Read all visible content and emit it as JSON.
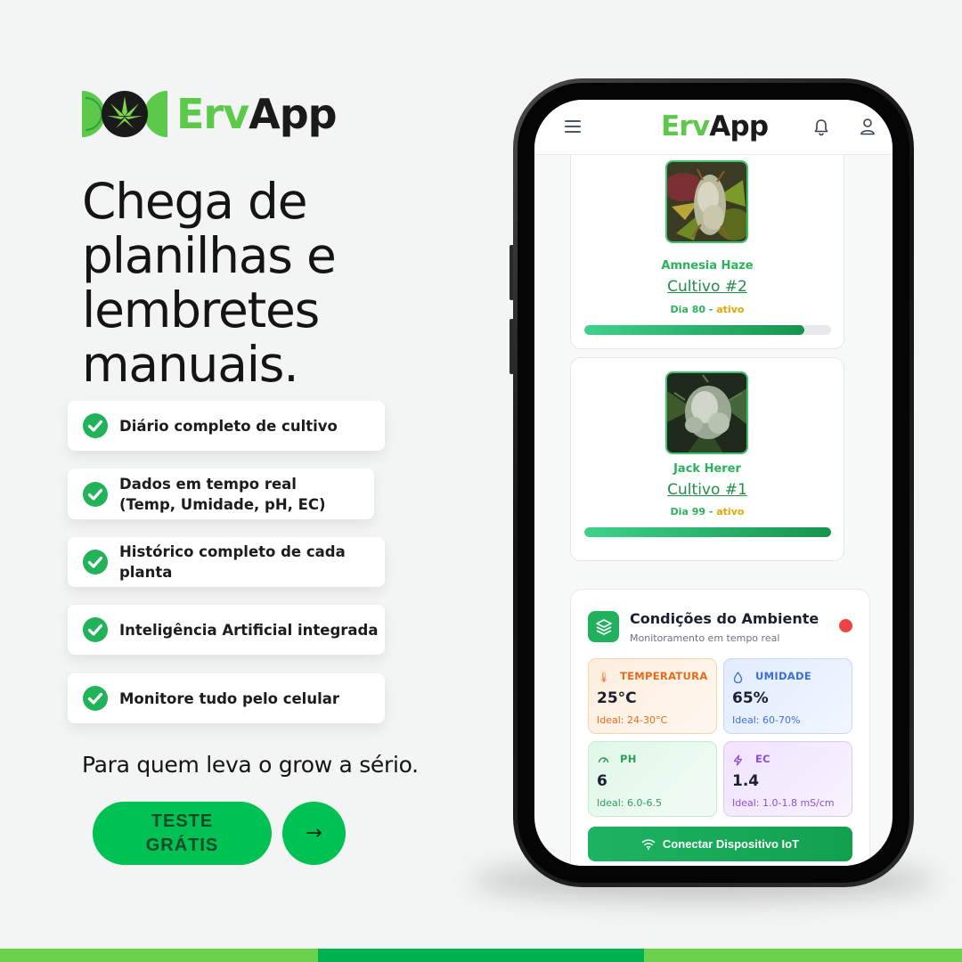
{
  "brand": {
    "logo_erv": "Erv",
    "logo_app": "App"
  },
  "headline": [
    "Chega de",
    "planilhas e",
    "lembretes",
    "manuais."
  ],
  "features": [
    {
      "label": "Diário completo de cultivo",
      "icon": "check-circle-icon"
    },
    {
      "label": "Dados em tempo real (Temp, Umidade, pH, EC)",
      "icon": "check-circle-icon"
    },
    {
      "label": "Histórico completo de cada planta",
      "icon": "check-circle-icon"
    },
    {
      "label": "Inteligência Artificial integrada",
      "icon": "check-circle-icon"
    },
    {
      "label": "Monitore tudo pelo celular",
      "icon": "check-circle-icon"
    }
  ],
  "tagline": "Para quem leva o grow a sério.",
  "cta": {
    "label": "TESTE GRÁTIS",
    "arrow": "→"
  },
  "colors": {
    "brand_green": "#5cc94a",
    "cta_green": "#00c153",
    "stripe_light": "#6bd24b",
    "stripe_dark": "#00b14f",
    "alert_red": "#ef4444"
  },
  "app": {
    "header": {
      "logo_erv": "Erv",
      "logo_app": "App",
      "icons": [
        "menu-icon",
        "bell-icon",
        "user-icon"
      ]
    },
    "grows": [
      {
        "strain": "Amnesia Haze",
        "title": "Cultivo #2",
        "day": "Dia 80",
        "status": "ativo",
        "progress": 0.89
      },
      {
        "strain": "Jack Herer",
        "title": "Cultivo #1",
        "day": "Dia 99",
        "status": "ativo",
        "progress": 1.0
      }
    ],
    "environment": {
      "title": "Condições do Ambiente",
      "subtitle": "Monitoramento em tempo real",
      "status_color": "#ef4444",
      "sensors": {
        "temperature": {
          "label": "TEMPERATURA",
          "value": "25°C",
          "ideal": "Ideal: 24-30°C",
          "icon": "thermometer-icon"
        },
        "humidity": {
          "label": "UMIDADE",
          "value": "65%",
          "ideal": "Ideal: 60-70%",
          "icon": "droplet-icon"
        },
        "ph": {
          "label": "PH",
          "value": "6",
          "ideal": "Ideal: 6.0-6.5",
          "icon": "gauge-icon"
        },
        "ec": {
          "label": "EC",
          "value": "1.4",
          "ideal": "Ideal: 1.0-1.8 mS/cm",
          "icon": "bolt-icon"
        }
      },
      "connect_label": "Conectar Dispositivo IoT"
    }
  }
}
